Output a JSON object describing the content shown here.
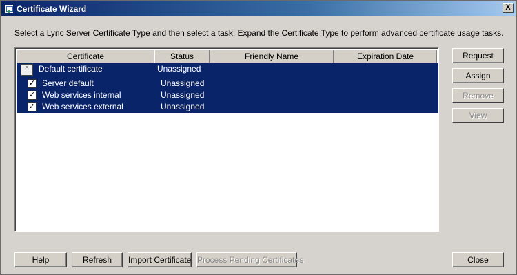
{
  "window": {
    "title": "Certificate Wizard",
    "close_label": "X"
  },
  "instructions": "Select a Lync Server Certificate Type and then select a task. Expand the Certificate Type to perform advanced certificate usage tasks.",
  "grid": {
    "columns": [
      "Certificate",
      "Status",
      "Friendly Name",
      "Expiration Date"
    ],
    "group": {
      "expander": "^",
      "name": "Default certificate",
      "status": "Unassigned"
    },
    "rows": [
      {
        "checked": "✓",
        "name": "Server default",
        "status": "Unassigned"
      },
      {
        "checked": "✓",
        "name": "Web services internal",
        "status": "Unassigned"
      },
      {
        "checked": "✓",
        "name": "Web services external",
        "status": "Unassigned"
      }
    ]
  },
  "side_buttons": {
    "request": "Request",
    "assign": "Assign",
    "remove": "Remove",
    "view": "View"
  },
  "bottom_buttons": {
    "help": "Help",
    "refresh": "Refresh",
    "import": "Import Certificate",
    "process_pending": "Process Pending Certificates",
    "close": "Close"
  }
}
